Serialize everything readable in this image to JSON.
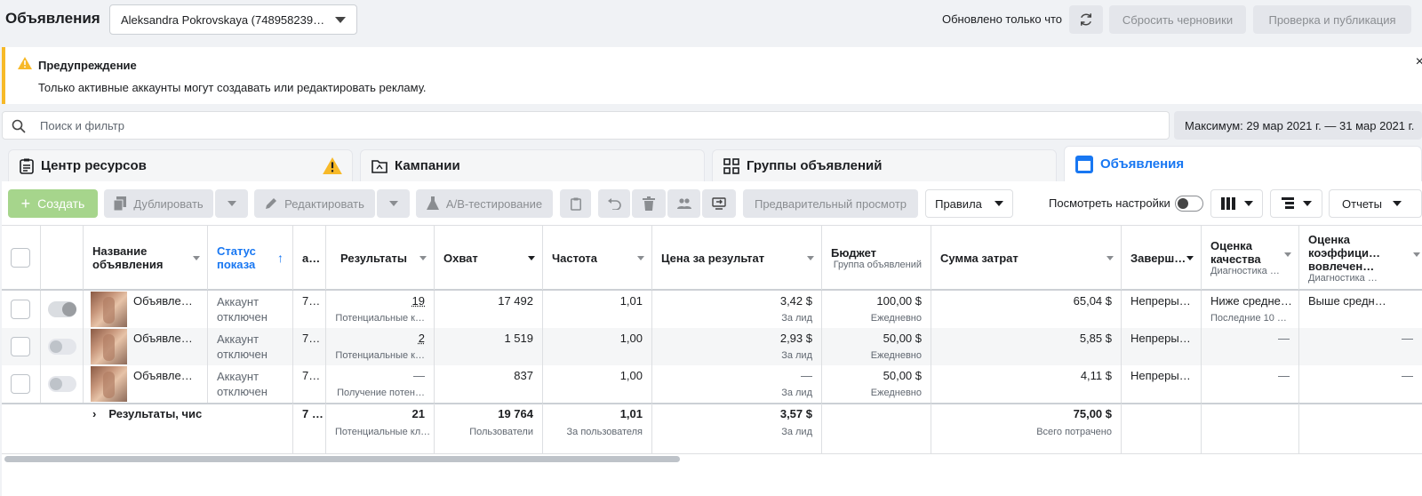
{
  "header": {
    "title": "Объявления",
    "account": "Aleksandra Pokrovskaya (748958239…",
    "updated": "Обновлено только что",
    "discard": "Сбросить черновики",
    "publish": "Проверка и публикация"
  },
  "warning": {
    "title": "Предупреждение",
    "text": "Только активные аккаунты могут создавать или редактировать рекламу.",
    "close": "×"
  },
  "search": {
    "placeholder": "Поиск и фильтр",
    "date_range": "Максимум: 29 мар 2021 г. — 31 мар 2021 г."
  },
  "tabs": [
    {
      "label": "Центр ресурсов",
      "icon": "clipboard-icon"
    },
    {
      "label": "Кампании",
      "icon": "folder-icon"
    },
    {
      "label": "Группы объявлений",
      "icon": "grid-icon"
    },
    {
      "label": "Объявления",
      "icon": "ad-icon"
    }
  ],
  "toolbar": {
    "create": "Создать",
    "duplicate": "Дублировать",
    "edit": "Редактировать",
    "ab_test": "A/B-тестирование",
    "preview": "Предварительный просмотр",
    "rules": "Правила",
    "view_settings": "Посмотреть настройки",
    "reports": "Отчеты"
  },
  "columns": {
    "name": "Название объявления",
    "status": "Статус показа",
    "a": "а…",
    "results": "Результаты",
    "reach": "Охват",
    "frequency": "Частота",
    "cost_per_result": "Цена за результат",
    "budget": "Бюджет",
    "budget_sub": "Группа объявлений",
    "spent": "Сумма затрат",
    "ends": "Заверш…",
    "quality": "Оценка качества",
    "quality_sub": "Диагностика …",
    "engagement": "Оценка коэффици… вовлечен…",
    "engagement_sub": "Диагностика …"
  },
  "rows": [
    {
      "name": "Объявле…",
      "status": "Аккаунт отключен",
      "a": "7…",
      "results": "19",
      "results_sub": "Потенциальные к…",
      "reach": "17 492",
      "frequency": "1,01",
      "cpr": "3,42 $",
      "cpr_sub": "За лид",
      "budget": "100,00 $",
      "budget_sub": "Ежедневно",
      "spent": "65,04 $",
      "ends": "Непреры…",
      "quality": "Ниже средне…",
      "quality_sub": "Последние 10 …",
      "engagement": "Выше средн…"
    },
    {
      "name": "Объявле…",
      "status": "Аккаунт отключен",
      "a": "7…",
      "results": "2",
      "results_sub": "Потенциальные к…",
      "reach": "1 519",
      "frequency": "1,00",
      "cpr": "2,93 $",
      "cpr_sub": "За лид",
      "budget": "50,00 $",
      "budget_sub": "Ежедневно",
      "spent": "5,85 $",
      "ends": "Непреры…",
      "quality": "—",
      "quality_sub": "",
      "engagement": "—"
    },
    {
      "name": "Объявле…",
      "status": "Аккаунт отключен",
      "a": "7…",
      "results": "—",
      "results_sub": "Получение потен…",
      "reach": "837",
      "frequency": "1,00",
      "cpr": "—",
      "cpr_sub": "За лид",
      "budget": "50,00 $",
      "budget_sub": "Ежедневно",
      "spent": "4,11 $",
      "ends": "Непреры…",
      "quality": "—",
      "quality_sub": "",
      "engagement": "—"
    }
  ],
  "totals": {
    "label": "Результаты, чис",
    "a": "7 …",
    "results": "21",
    "results_sub": "Потенциальные кл…",
    "reach": "19 764",
    "reach_sub": "Пользователи",
    "frequency": "1,01",
    "frequency_sub": "За пользователя",
    "cpr": "3,57 $",
    "cpr_sub": "За лид",
    "spent": "75,00 $",
    "spent_sub": "Всего потрачено"
  },
  "colors": {
    "accent": "#1877f2",
    "warning": "#f7b928",
    "create_bg": "#a6d58c"
  }
}
